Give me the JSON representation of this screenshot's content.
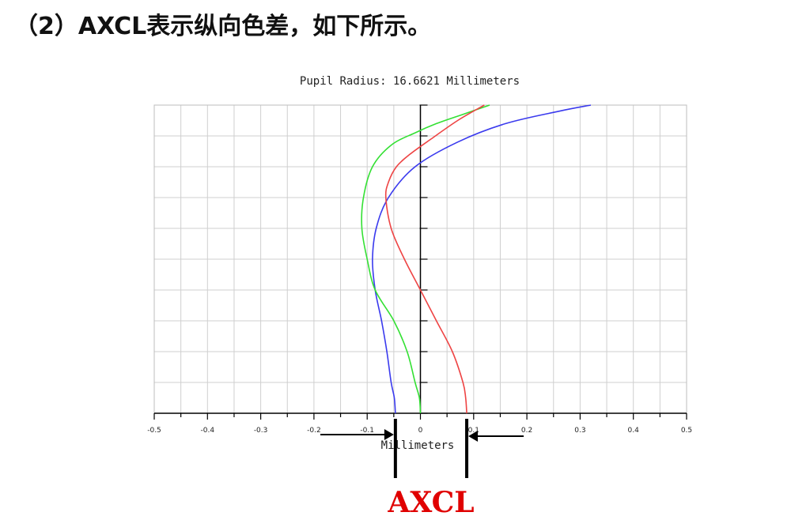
{
  "heading": "（2）AXCL表示纵向色差，如下所示。",
  "annotation_label": "AXCL",
  "colors": {
    "blue": "#3a3aee",
    "green": "#33e033",
    "red": "#ee4444",
    "grid": "#cfcfcf",
    "accent": "#e00000"
  },
  "chart_data": {
    "type": "line",
    "title": "Pupil Radius: 16.6621 Millimeters",
    "xlabel": "Millimeters",
    "ylabel": "",
    "xlim": [
      -0.5,
      0.5
    ],
    "ylim": [
      0,
      1
    ],
    "x_ticks": [
      "-0.5",
      "-0.4",
      "-0.3",
      "-0.2",
      "-0.1",
      "0",
      "0.1",
      "0.2",
      "0.3",
      "0.4",
      "0.5"
    ],
    "grid": true,
    "series": [
      {
        "color": "#3a3aee",
        "points": [
          {
            "x": -0.047,
            "y": 0
          },
          {
            "x": -0.049,
            "y": 0.05
          },
          {
            "x": -0.055,
            "y": 0.1
          },
          {
            "x": -0.063,
            "y": 0.2
          },
          {
            "x": -0.073,
            "y": 0.3
          },
          {
            "x": -0.085,
            "y": 0.4
          },
          {
            "x": -0.09,
            "y": 0.5
          },
          {
            "x": -0.083,
            "y": 0.6
          },
          {
            "x": -0.06,
            "y": 0.7
          },
          {
            "x": -0.01,
            "y": 0.8
          },
          {
            "x": 0.07,
            "y": 0.88
          },
          {
            "x": 0.16,
            "y": 0.94
          },
          {
            "x": 0.26,
            "y": 0.98
          },
          {
            "x": 0.32,
            "y": 1.0
          }
        ]
      },
      {
        "color": "#33e033",
        "points": [
          {
            "x": 0.0,
            "y": 0
          },
          {
            "x": -0.002,
            "y": 0.05
          },
          {
            "x": -0.01,
            "y": 0.1
          },
          {
            "x": -0.025,
            "y": 0.2
          },
          {
            "x": -0.05,
            "y": 0.3
          },
          {
            "x": -0.085,
            "y": 0.4
          },
          {
            "x": -0.1,
            "y": 0.5
          },
          {
            "x": -0.11,
            "y": 0.6
          },
          {
            "x": -0.107,
            "y": 0.7
          },
          {
            "x": -0.09,
            "y": 0.8
          },
          {
            "x": -0.055,
            "y": 0.87
          },
          {
            "x": -0.01,
            "y": 0.91
          },
          {
            "x": 0.03,
            "y": 0.94
          },
          {
            "x": 0.08,
            "y": 0.97
          },
          {
            "x": 0.13,
            "y": 1.0
          }
        ]
      },
      {
        "color": "#ee4444",
        "points": [
          {
            "x": 0.087,
            "y": 0
          },
          {
            "x": 0.085,
            "y": 0.05
          },
          {
            "x": 0.08,
            "y": 0.1
          },
          {
            "x": 0.06,
            "y": 0.2
          },
          {
            "x": 0.03,
            "y": 0.3
          },
          {
            "x": 0.0,
            "y": 0.4
          },
          {
            "x": -0.03,
            "y": 0.5
          },
          {
            "x": -0.055,
            "y": 0.6
          },
          {
            "x": -0.065,
            "y": 0.7
          },
          {
            "x": -0.06,
            "y": 0.75
          },
          {
            "x": -0.045,
            "y": 0.8
          },
          {
            "x": -0.02,
            "y": 0.84
          },
          {
            "x": 0.02,
            "y": 0.89
          },
          {
            "x": 0.07,
            "y": 0.95
          },
          {
            "x": 0.12,
            "y": 1.0
          }
        ]
      }
    ],
    "axcl_range": [
      -0.047,
      0.087
    ]
  }
}
